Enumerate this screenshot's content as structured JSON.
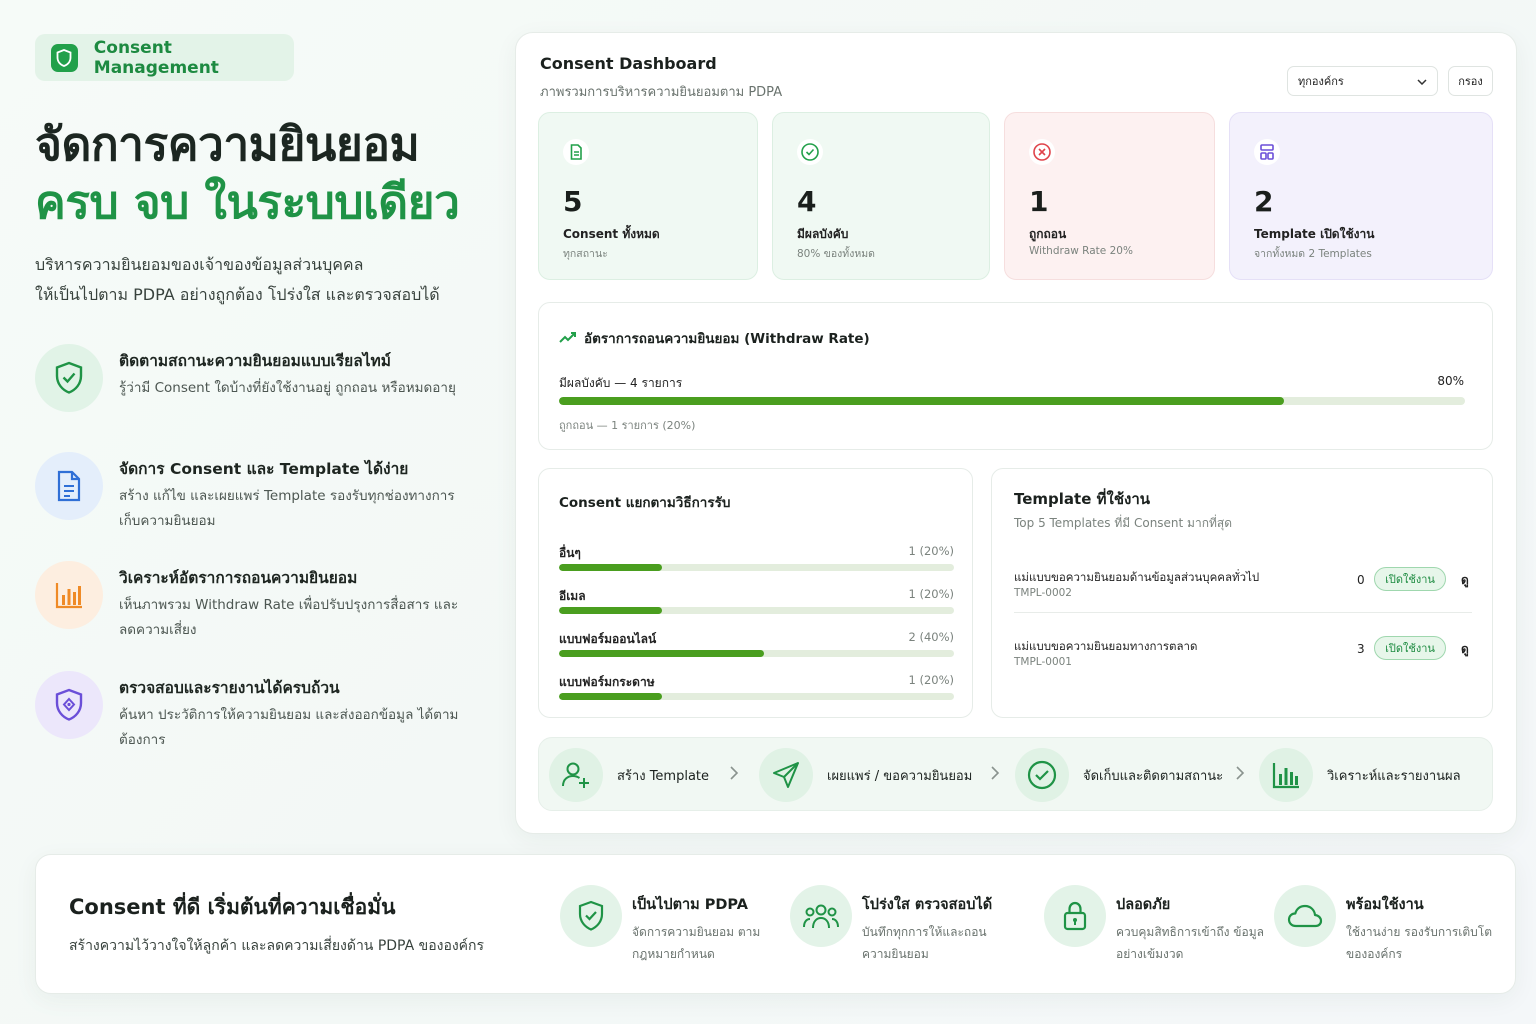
{
  "brand": {
    "label": "Consent Management"
  },
  "hero": {
    "line1": "จัดการความยินยอม",
    "line2": "ครบ จบ ในระบบเดียว",
    "sub_line1": "บริหารความยินยอมของเจ้าของข้อมูลส่วนบุคคล",
    "sub_line2": "ให้เป็นไปตาม PDPA อย่างถูกต้อง โปร่งใส และตรวจสอบได้"
  },
  "features": [
    {
      "icon": "shield-check-icon",
      "title": "ติดตามสถานะความยินยอมแบบเรียลไทม์",
      "desc": "รู้ว่ามี Consent ใดบ้างที่ยังใช้งานอยู่ ถูกถอน หรือหมดอายุ"
    },
    {
      "icon": "document-icon",
      "title": "จัดการ Consent และ Template ได้ง่าย",
      "desc": "สร้าง แก้ไข และเผยแพร่ Template รองรับทุกช่องทางการเก็บความยินยอม"
    },
    {
      "icon": "bar-chart-icon",
      "title": "วิเคราะห์อัตราการถอนความยินยอม",
      "desc": "เห็นภาพรวม Withdraw Rate เพื่อปรับปรุงการสื่อสาร และลดความเสี่ยง"
    },
    {
      "icon": "shield-lock-icon",
      "title": "ตรวจสอบและรายงานได้ครบถ้วน",
      "desc": "ค้นหา ประวัติการให้ความยินยอม และส่งออกข้อมูล ได้ตามต้องการ"
    }
  ],
  "dashboard": {
    "title": "Consent Dashboard",
    "subtitle": "ภาพรวมการบริหารความยินยอมตาม PDPA",
    "org_select": "ทุกองค์กร",
    "filter_label": "กรอง",
    "stats": [
      {
        "icon": "document-icon",
        "value": "5",
        "label": "Consent ทั้งหมด",
        "sub": "ทุกสถานะ",
        "color": "#22a04a"
      },
      {
        "icon": "check-circle-icon",
        "value": "4",
        "label": "มีผลบังคับ",
        "sub": "80% ของทั้งหมด",
        "color": "#22a04a"
      },
      {
        "icon": "x-circle-icon",
        "value": "1",
        "label": "ถูกถอน",
        "sub": "Withdraw Rate 20%",
        "color": "#e0434a"
      },
      {
        "icon": "layout-icon",
        "value": "2",
        "label": "Template เปิดใช้งาน",
        "sub": "จากทั้งหมด 2 Templates",
        "color": "#6b4fd8"
      }
    ],
    "withdraw": {
      "title": "อัตราการถอนความยินยอม (Withdraw Rate)",
      "active_label": "มีผลบังคับ — 4 รายการ",
      "active_pct": "80%",
      "active_fraction": 0.8,
      "withdrawn_label": "ถูกถอน — 1 รายการ (20%)"
    },
    "channels": {
      "title": "Consent แยกตามวิธีการรับ",
      "rows": [
        {
          "label": "อื่นๆ",
          "value": "1 (20%)",
          "fraction": 0.2
        },
        {
          "label": "อีเมล",
          "value": "1 (20%)",
          "fraction": 0.2
        },
        {
          "label": "แบบฟอร์มออนไลน์",
          "value": "2 (40%)",
          "fraction": 0.4
        },
        {
          "label": "แบบฟอร์มกระดาษ",
          "value": "1 (20%)",
          "fraction": 0.2
        }
      ]
    },
    "templates": {
      "title": "Template ที่ใช้งาน",
      "subtitle": "Top 5 Templates ที่มี Consent มากที่สุด",
      "rows": [
        {
          "name": "แม่แบบขอความยินยอมด้านข้อมูลส่วนบุคคลทั่วไป",
          "code": "TMPL-0002",
          "count": "0",
          "status": "เปิดใช้งาน",
          "action": "ดู"
        },
        {
          "name": "แม่แบบขอความยินยอมทางการตลาด",
          "code": "TMPL-0001",
          "count": "3",
          "status": "เปิดใช้งาน",
          "action": "ดู"
        }
      ]
    },
    "flow": [
      {
        "icon": "user-plus-icon",
        "label": "สร้าง Template"
      },
      {
        "icon": "send-icon",
        "label": "เผยแพร่ / ขอความยินยอม"
      },
      {
        "icon": "check-circle-icon",
        "label": "จัดเก็บและติดตามสถานะ"
      },
      {
        "icon": "bar-chart-icon",
        "label": "วิเคราะห์และรายงานผล"
      }
    ]
  },
  "bottom": {
    "title": "Consent ที่ดี เริ่มต้นที่ความเชื่อมั่น",
    "subtitle": "สร้างความไว้วางใจให้ลูกค้า และลดความเสี่ยงด้าน PDPA ขององค์กร",
    "points": [
      {
        "icon": "shield-check-icon",
        "title": "เป็นไปตาม PDPA",
        "desc": "จัดการความยินยอม ตามกฎหมายกำหนด"
      },
      {
        "icon": "users-icon",
        "title": "โปร่งใส ตรวจสอบได้",
        "desc": "บันทึกทุกการให้และถอน ความยินยอม"
      },
      {
        "icon": "lock-icon",
        "title": "ปลอดภัย",
        "desc": "ควบคุมสิทธิการเข้าถึง ข้อมูลอย่างเข้มงวด"
      },
      {
        "icon": "cloud-icon",
        "title": "พร้อมใช้งาน",
        "desc": "ใช้งานง่าย รองรับการเติบโต ขององค์กร"
      }
    ]
  }
}
